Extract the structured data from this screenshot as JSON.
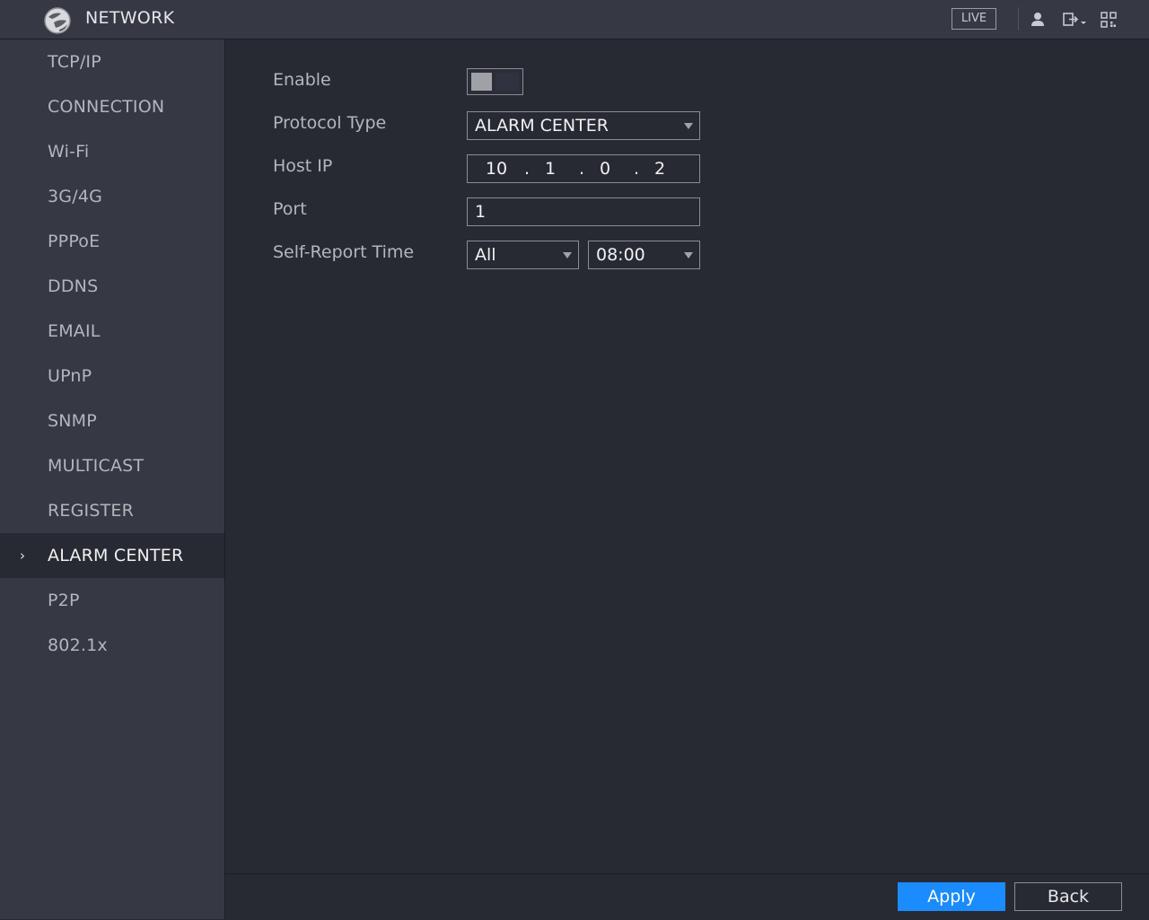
{
  "header": {
    "title": "NETWORK",
    "live_label": "LIVE",
    "icons": [
      "globe-logo-icon",
      "user-icon",
      "logout-icon",
      "qr-code-icon"
    ]
  },
  "sidebar": {
    "items": [
      {
        "label": "TCP/IP"
      },
      {
        "label": "CONNECTION"
      },
      {
        "label": "Wi-Fi"
      },
      {
        "label": "3G/4G"
      },
      {
        "label": "PPPoE"
      },
      {
        "label": "DDNS"
      },
      {
        "label": "EMAIL"
      },
      {
        "label": "UPnP"
      },
      {
        "label": "SNMP"
      },
      {
        "label": "MULTICAST"
      },
      {
        "label": "REGISTER"
      },
      {
        "label": "ALARM CENTER",
        "active": true
      },
      {
        "label": "P2P"
      },
      {
        "label": "802.1x"
      }
    ]
  },
  "form": {
    "enable_label": "Enable",
    "enable_value": false,
    "protocol_label": "Protocol Type",
    "protocol_value": "ALARM CENTER",
    "host_ip_label": "Host IP",
    "host_ip": [
      "10",
      "1",
      "0",
      "2"
    ],
    "port_label": "Port",
    "port_value": "1",
    "self_report_label": "Self-Report Time",
    "self_report_day": "All",
    "self_report_time": "08:00"
  },
  "footer": {
    "apply_label": "Apply",
    "back_label": "Back"
  },
  "colors": {
    "accent": "#1a8cff",
    "background": "#282a33",
    "panel": "#363843"
  }
}
